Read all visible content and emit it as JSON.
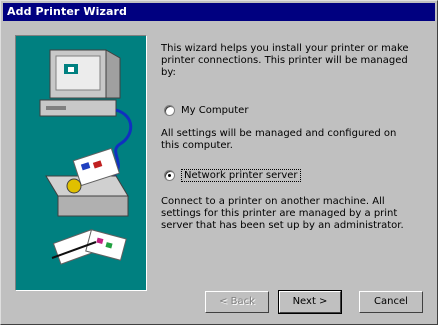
{
  "window": {
    "title": "Add Printer Wizard"
  },
  "intro_text": "This wizard helps you install your printer or make printer connections. This printer will be managed by:",
  "options": [
    {
      "label": "My Computer",
      "checked": false,
      "description": "All settings will be managed and configured on this computer."
    },
    {
      "label": "Network printer server",
      "checked": true,
      "description": "Connect to a printer on another machine. All settings for this printer are managed by a print server that has been set up by an administrator."
    }
  ],
  "buttons": {
    "back": "< Back",
    "next": "Next >",
    "cancel": "Cancel"
  },
  "colors": {
    "titlebar": "#000080",
    "panel": "#008080",
    "face": "#c0c0c0"
  }
}
